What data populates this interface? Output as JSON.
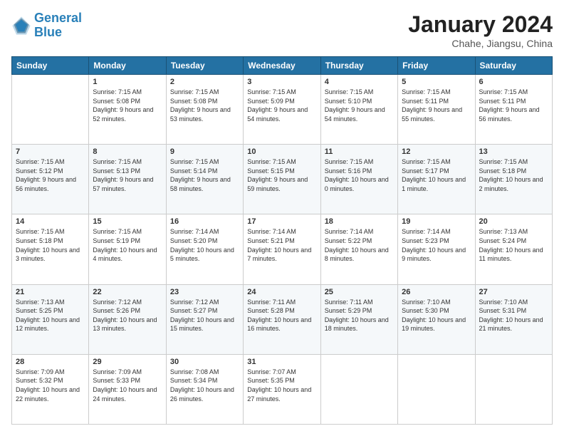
{
  "app": {
    "logo_line1": "General",
    "logo_line2": "Blue"
  },
  "header": {
    "title": "January 2024",
    "location": "Chahe, Jiangsu, China"
  },
  "columns": [
    "Sunday",
    "Monday",
    "Tuesday",
    "Wednesday",
    "Thursday",
    "Friday",
    "Saturday"
  ],
  "weeks": [
    [
      {
        "day": "",
        "sunrise": "",
        "sunset": "",
        "daylight": ""
      },
      {
        "day": "1",
        "sunrise": "Sunrise: 7:15 AM",
        "sunset": "Sunset: 5:08 PM",
        "daylight": "Daylight: 9 hours and 52 minutes."
      },
      {
        "day": "2",
        "sunrise": "Sunrise: 7:15 AM",
        "sunset": "Sunset: 5:08 PM",
        "daylight": "Daylight: 9 hours and 53 minutes."
      },
      {
        "day": "3",
        "sunrise": "Sunrise: 7:15 AM",
        "sunset": "Sunset: 5:09 PM",
        "daylight": "Daylight: 9 hours and 54 minutes."
      },
      {
        "day": "4",
        "sunrise": "Sunrise: 7:15 AM",
        "sunset": "Sunset: 5:10 PM",
        "daylight": "Daylight: 9 hours and 54 minutes."
      },
      {
        "day": "5",
        "sunrise": "Sunrise: 7:15 AM",
        "sunset": "Sunset: 5:11 PM",
        "daylight": "Daylight: 9 hours and 55 minutes."
      },
      {
        "day": "6",
        "sunrise": "Sunrise: 7:15 AM",
        "sunset": "Sunset: 5:11 PM",
        "daylight": "Daylight: 9 hours and 56 minutes."
      }
    ],
    [
      {
        "day": "7",
        "sunrise": "Sunrise: 7:15 AM",
        "sunset": "Sunset: 5:12 PM",
        "daylight": "Daylight: 9 hours and 56 minutes."
      },
      {
        "day": "8",
        "sunrise": "Sunrise: 7:15 AM",
        "sunset": "Sunset: 5:13 PM",
        "daylight": "Daylight: 9 hours and 57 minutes."
      },
      {
        "day": "9",
        "sunrise": "Sunrise: 7:15 AM",
        "sunset": "Sunset: 5:14 PM",
        "daylight": "Daylight: 9 hours and 58 minutes."
      },
      {
        "day": "10",
        "sunrise": "Sunrise: 7:15 AM",
        "sunset": "Sunset: 5:15 PM",
        "daylight": "Daylight: 9 hours and 59 minutes."
      },
      {
        "day": "11",
        "sunrise": "Sunrise: 7:15 AM",
        "sunset": "Sunset: 5:16 PM",
        "daylight": "Daylight: 10 hours and 0 minutes."
      },
      {
        "day": "12",
        "sunrise": "Sunrise: 7:15 AM",
        "sunset": "Sunset: 5:17 PM",
        "daylight": "Daylight: 10 hours and 1 minute."
      },
      {
        "day": "13",
        "sunrise": "Sunrise: 7:15 AM",
        "sunset": "Sunset: 5:18 PM",
        "daylight": "Daylight: 10 hours and 2 minutes."
      }
    ],
    [
      {
        "day": "14",
        "sunrise": "Sunrise: 7:15 AM",
        "sunset": "Sunset: 5:18 PM",
        "daylight": "Daylight: 10 hours and 3 minutes."
      },
      {
        "day": "15",
        "sunrise": "Sunrise: 7:15 AM",
        "sunset": "Sunset: 5:19 PM",
        "daylight": "Daylight: 10 hours and 4 minutes."
      },
      {
        "day": "16",
        "sunrise": "Sunrise: 7:14 AM",
        "sunset": "Sunset: 5:20 PM",
        "daylight": "Daylight: 10 hours and 5 minutes."
      },
      {
        "day": "17",
        "sunrise": "Sunrise: 7:14 AM",
        "sunset": "Sunset: 5:21 PM",
        "daylight": "Daylight: 10 hours and 7 minutes."
      },
      {
        "day": "18",
        "sunrise": "Sunrise: 7:14 AM",
        "sunset": "Sunset: 5:22 PM",
        "daylight": "Daylight: 10 hours and 8 minutes."
      },
      {
        "day": "19",
        "sunrise": "Sunrise: 7:14 AM",
        "sunset": "Sunset: 5:23 PM",
        "daylight": "Daylight: 10 hours and 9 minutes."
      },
      {
        "day": "20",
        "sunrise": "Sunrise: 7:13 AM",
        "sunset": "Sunset: 5:24 PM",
        "daylight": "Daylight: 10 hours and 11 minutes."
      }
    ],
    [
      {
        "day": "21",
        "sunrise": "Sunrise: 7:13 AM",
        "sunset": "Sunset: 5:25 PM",
        "daylight": "Daylight: 10 hours and 12 minutes."
      },
      {
        "day": "22",
        "sunrise": "Sunrise: 7:12 AM",
        "sunset": "Sunset: 5:26 PM",
        "daylight": "Daylight: 10 hours and 13 minutes."
      },
      {
        "day": "23",
        "sunrise": "Sunrise: 7:12 AM",
        "sunset": "Sunset: 5:27 PM",
        "daylight": "Daylight: 10 hours and 15 minutes."
      },
      {
        "day": "24",
        "sunrise": "Sunrise: 7:11 AM",
        "sunset": "Sunset: 5:28 PM",
        "daylight": "Daylight: 10 hours and 16 minutes."
      },
      {
        "day": "25",
        "sunrise": "Sunrise: 7:11 AM",
        "sunset": "Sunset: 5:29 PM",
        "daylight": "Daylight: 10 hours and 18 minutes."
      },
      {
        "day": "26",
        "sunrise": "Sunrise: 7:10 AM",
        "sunset": "Sunset: 5:30 PM",
        "daylight": "Daylight: 10 hours and 19 minutes."
      },
      {
        "day": "27",
        "sunrise": "Sunrise: 7:10 AM",
        "sunset": "Sunset: 5:31 PM",
        "daylight": "Daylight: 10 hours and 21 minutes."
      }
    ],
    [
      {
        "day": "28",
        "sunrise": "Sunrise: 7:09 AM",
        "sunset": "Sunset: 5:32 PM",
        "daylight": "Daylight: 10 hours and 22 minutes."
      },
      {
        "day": "29",
        "sunrise": "Sunrise: 7:09 AM",
        "sunset": "Sunset: 5:33 PM",
        "daylight": "Daylight: 10 hours and 24 minutes."
      },
      {
        "day": "30",
        "sunrise": "Sunrise: 7:08 AM",
        "sunset": "Sunset: 5:34 PM",
        "daylight": "Daylight: 10 hours and 26 minutes."
      },
      {
        "day": "31",
        "sunrise": "Sunrise: 7:07 AM",
        "sunset": "Sunset: 5:35 PM",
        "daylight": "Daylight: 10 hours and 27 minutes."
      },
      {
        "day": "",
        "sunrise": "",
        "sunset": "",
        "daylight": ""
      },
      {
        "day": "",
        "sunrise": "",
        "sunset": "",
        "daylight": ""
      },
      {
        "day": "",
        "sunrise": "",
        "sunset": "",
        "daylight": ""
      }
    ]
  ]
}
